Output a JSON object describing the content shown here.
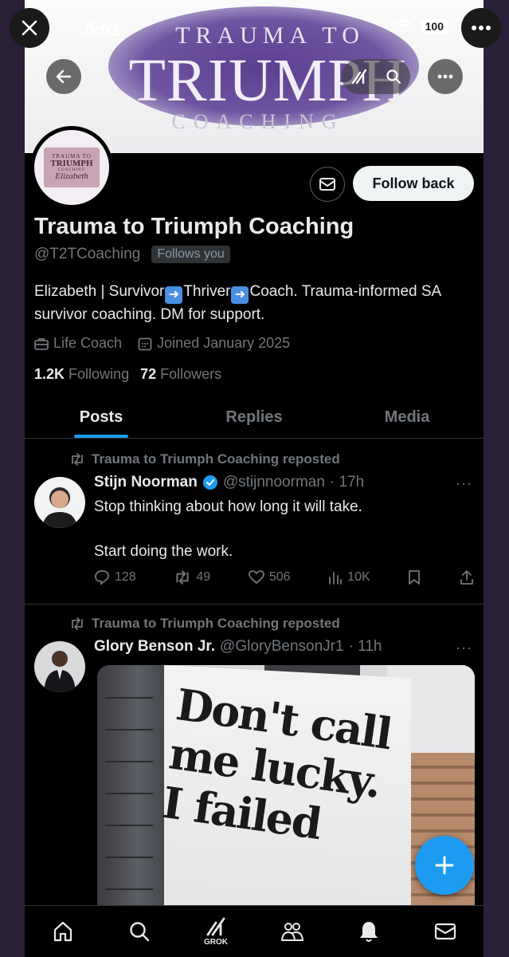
{
  "status_bar": {
    "time": "5:51",
    "battery": "100"
  },
  "banner": {
    "line1": "TRAUMA TO",
    "line2": "TRIUMPH",
    "line3": "COACHING"
  },
  "avatar": {
    "line1": "TRAUMA TO",
    "line2": "TRIUMPH",
    "line3": "COACHING",
    "line4": "Elizabeth"
  },
  "profile": {
    "follow_back_label": "Follow back",
    "name": "Trauma to Triumph Coaching",
    "handle": "@T2TCoaching",
    "follows_you": "Follows you",
    "bio_part1": "Elizabeth | Survivor",
    "bio_part2": "Thriver",
    "bio_part3": "Coach. Trauma-informed SA survivor coaching. DM for support.",
    "category": "Life Coach",
    "joined": "Joined January 2025",
    "following_count": "1.2K",
    "following_label": "Following",
    "followers_count": "72",
    "followers_label": "Followers"
  },
  "tabs": [
    {
      "label": "Posts",
      "active": true
    },
    {
      "label": "Replies",
      "active": false
    },
    {
      "label": "Media",
      "active": false
    }
  ],
  "posts": [
    {
      "repost_text": "Trauma to Triumph Coaching reposted",
      "author": "Stijn Noorman",
      "verified": true,
      "handle": "@stijnnoorman",
      "time": "· 17h",
      "text": "Stop thinking about how long it will take.\n\nStart doing the work.",
      "replies": "128",
      "reposts": "49",
      "likes": "506",
      "views": "10K"
    },
    {
      "repost_text": "Trauma to Triumph Coaching reposted",
      "author": "Glory Benson Jr.",
      "handle": "@GloryBensonJr1",
      "time": "· 11h",
      "image_text": "Don't call\nme lucky.\nI failed"
    }
  ],
  "nav": {
    "grok_label": "GROK"
  },
  "colors": {
    "accent": "#1d9bf0",
    "background": "#000000",
    "muted": "#71767b"
  }
}
